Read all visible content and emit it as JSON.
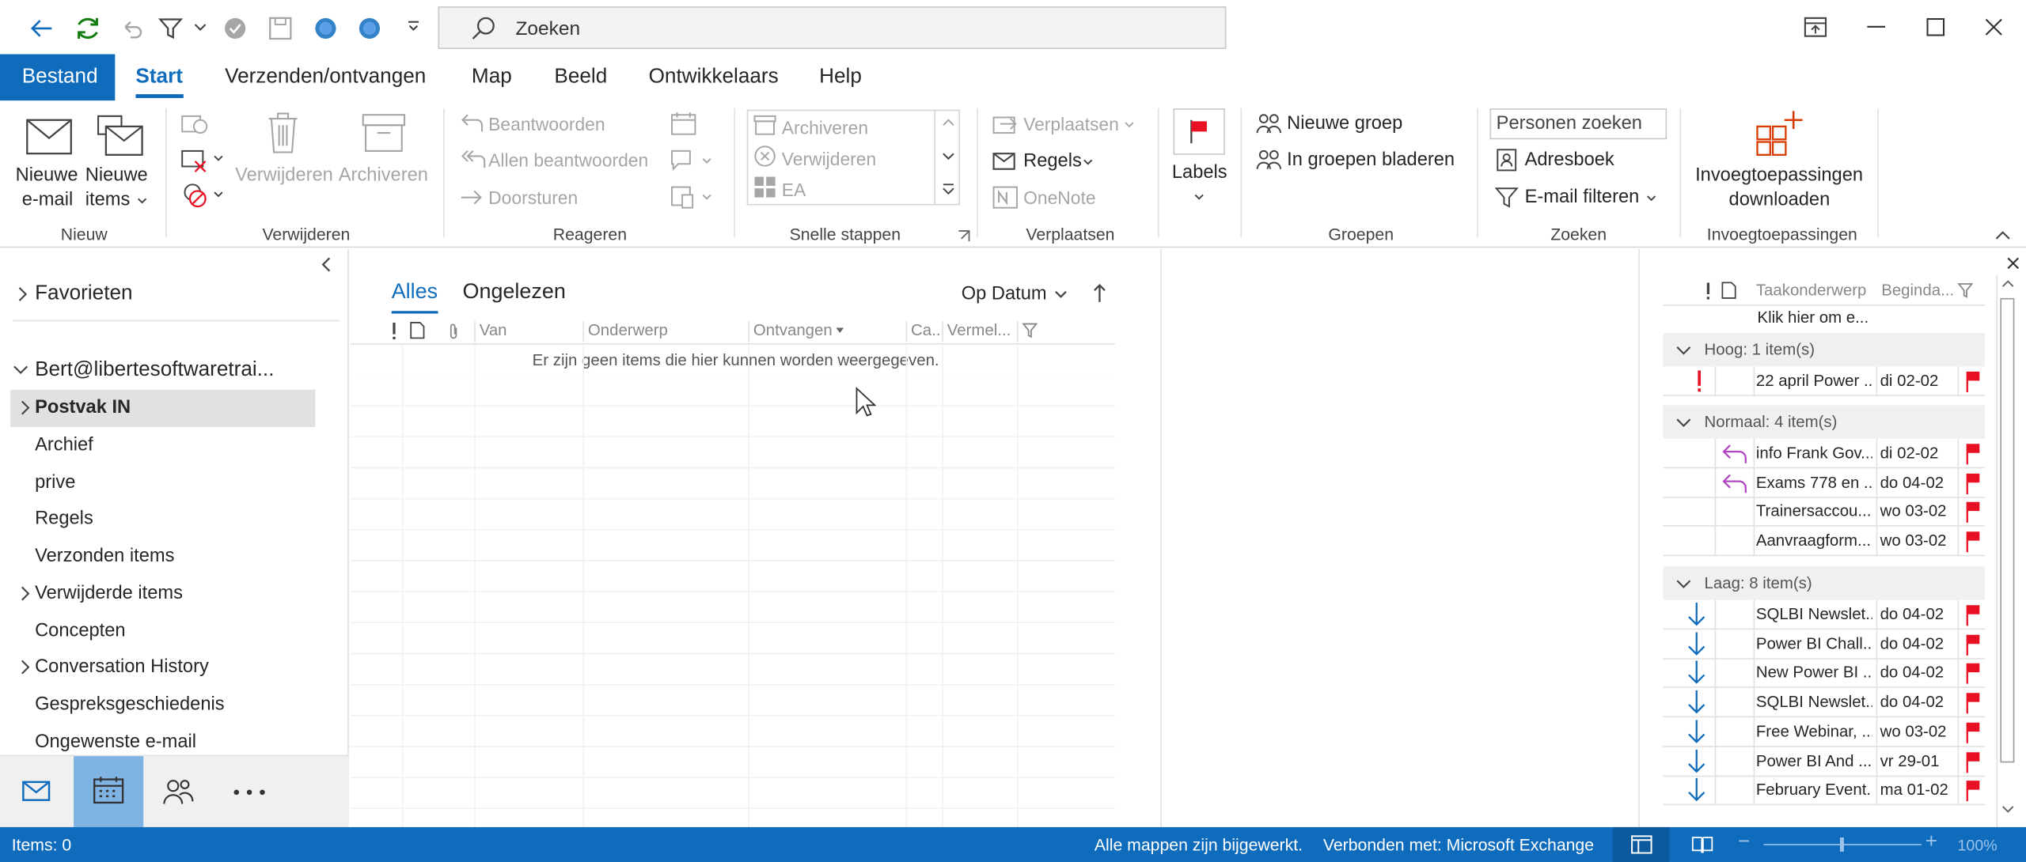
{
  "titlebar": {
    "search_placeholder": "Zoeken"
  },
  "ribbon_tabs": [
    "Bestand",
    "Start",
    "Verzenden/ontvangen",
    "Map",
    "Beeld",
    "Ontwikkelaars",
    "Help"
  ],
  "ribbon": {
    "nieuw": {
      "new_email_1": "Nieuwe",
      "new_email_2": "e-mail",
      "new_items_1": "Nieuwe",
      "new_items_2": "items",
      "label": "Nieuw"
    },
    "verwijderen": {
      "delete": "Verwijderen",
      "archive": "Archiveren",
      "label": "Verwijderen"
    },
    "reageren": {
      "reply": "Beantwoorden",
      "reply_all": "Allen beantwoorden",
      "forward": "Doorsturen",
      "label": "Reageren"
    },
    "snelle_stappen": {
      "items": [
        "Archiveren",
        "Verwijderen",
        "EA"
      ],
      "label": "Snelle stappen"
    },
    "verplaatsen": {
      "move": "Verplaatsen",
      "rules": "Regels",
      "onenote": "OneNote",
      "label": "Verplaatsen"
    },
    "labels": {
      "label": "Labels"
    },
    "groepen": {
      "new_group": "Nieuwe groep",
      "browse_groups": "In groepen bladeren",
      "label": "Groepen"
    },
    "zoeken": {
      "search_people": "Personen zoeken",
      "address_book": "Adresboek",
      "filter_email": "E-mail filteren",
      "label": "Zoeken"
    },
    "invoeg": {
      "get_addins_1": "Invoegtoepassingen",
      "get_addins_2": "downloaden",
      "label": "Invoegtoepassingen"
    }
  },
  "folders": {
    "favorites": "Favorieten",
    "account": "Bert@libertesoftwaretrai...",
    "items": [
      "Postvak IN",
      "Archief",
      "prive",
      "Regels",
      "Verzonden items",
      "Verwijderde items",
      "Concepten",
      "Conversation History",
      "Gespreksgeschiedenis",
      "Ongewenste e-mail"
    ]
  },
  "maillist": {
    "tab_all": "Alles",
    "tab_unread": "Ongelezen",
    "sort": "Op Datum",
    "columns": [
      "Van",
      "Onderwerp",
      "Ontvangen",
      "Ca...",
      "Vermel..."
    ],
    "empty_message": "Er zijn geen items die hier kunnen worden weergegeven."
  },
  "todo": {
    "columns": [
      "Taakonderwerp",
      "Beginda..."
    ],
    "new_task": "Klik hier om e...",
    "groups": [
      {
        "title": "Hoog: 1 item(s)",
        "items": [
          {
            "subject": "22 april Power ...",
            "date": "di 02-02",
            "icon": "exclamation-icon"
          }
        ]
      },
      {
        "title": "Normaal: 4 item(s)",
        "items": [
          {
            "subject": "info Frank Gov...",
            "date": "di 02-02",
            "icon": "reply-icon"
          },
          {
            "subject": "Exams 778 en ...",
            "date": "do 04-02",
            "icon": "reply-icon"
          },
          {
            "subject": "Trainersaccou...",
            "date": "wo 03-02",
            "icon": ""
          },
          {
            "subject": "Aanvraagform...",
            "date": "wo 03-02",
            "icon": ""
          }
        ]
      },
      {
        "title": "Laag: 8 item(s)",
        "items": [
          {
            "subject": "SQLBI Newslet...",
            "date": "do 04-02",
            "icon": "down-arrow-icon"
          },
          {
            "subject": "Power BI Chall...",
            "date": "do 04-02",
            "icon": "down-arrow-icon"
          },
          {
            "subject": "New Power BI ...",
            "date": "do 04-02",
            "icon": "down-arrow-icon"
          },
          {
            "subject": "SQLBI Newslet...",
            "date": "do 04-02",
            "icon": "down-arrow-icon"
          },
          {
            "subject": "Free Webinar, ...",
            "date": "wo 03-02",
            "icon": "down-arrow-icon"
          },
          {
            "subject": "Power BI And ...",
            "date": "vr 29-01",
            "icon": "down-arrow-icon"
          },
          {
            "subject": "February Event...",
            "date": "ma 01-02",
            "icon": "down-arrow-icon"
          }
        ]
      }
    ]
  },
  "statusbar": {
    "items": "Items: 0",
    "sync": "Alle mappen zijn bijgewerkt.",
    "connected": "Verbonden met: Microsoft Exchange",
    "zoom": "100%"
  },
  "colors": {
    "accent": "#0f6cbd",
    "flag": "#e81123",
    "reply": "#b146c2"
  }
}
